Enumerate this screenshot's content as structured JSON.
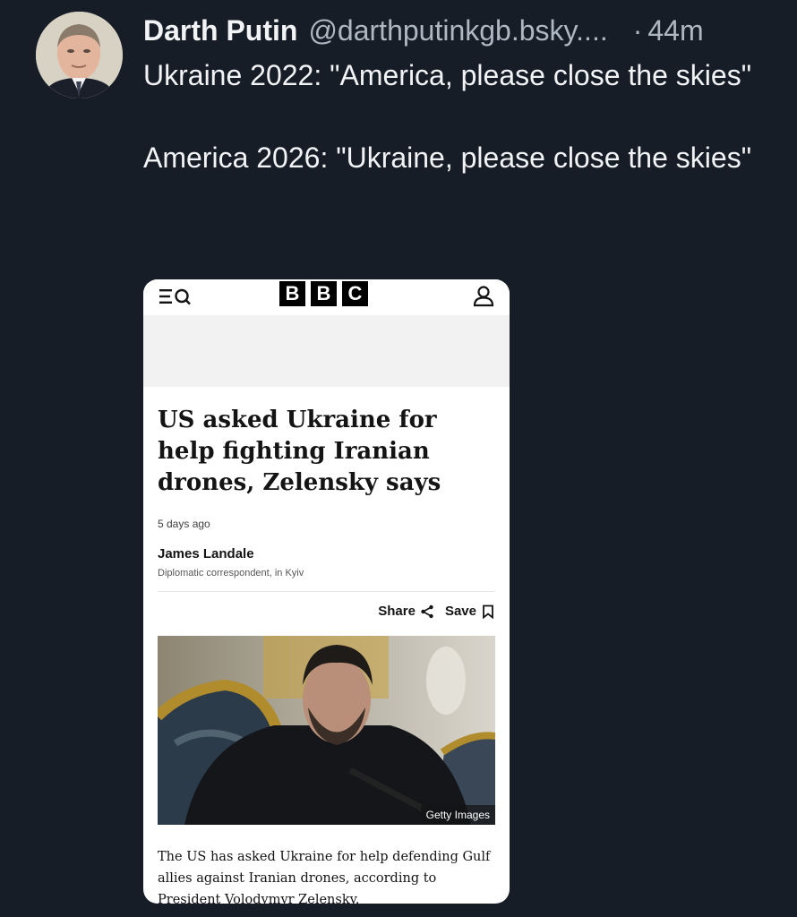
{
  "post": {
    "display_name": "Darth Putin",
    "handle": "@darthputinkgb.bsky....",
    "separator": "·",
    "time": "44m",
    "text_line_1": "Ukraine 2022: \"America, please close the skies\"",
    "text_line_2": "America 2026: \"Ukraine, please close the skies\""
  },
  "embed": {
    "logo_letters": [
      "B",
      "B",
      "C"
    ],
    "headline": "US asked Ukraine for help fighting Iranian drones, Zelensky says",
    "dateline": "5 days ago",
    "author_name": "James Landale",
    "author_role": "Diplomatic correspondent, in Kyiv",
    "share_label": "Share",
    "save_label": "Save",
    "photo_credit": "Getty Images",
    "body": "The US has asked Ukraine for help defending Gulf allies against Iranian drones, according to President Volodymyr Zelensky."
  },
  "colors": {
    "background": "#161d27",
    "primary_text": "#f1f3f5",
    "secondary_text": "#aeb7c2"
  },
  "icons": {
    "menu": "menu-search-icon",
    "account": "account-icon",
    "share": "share-icon",
    "save": "bookmark-icon"
  }
}
